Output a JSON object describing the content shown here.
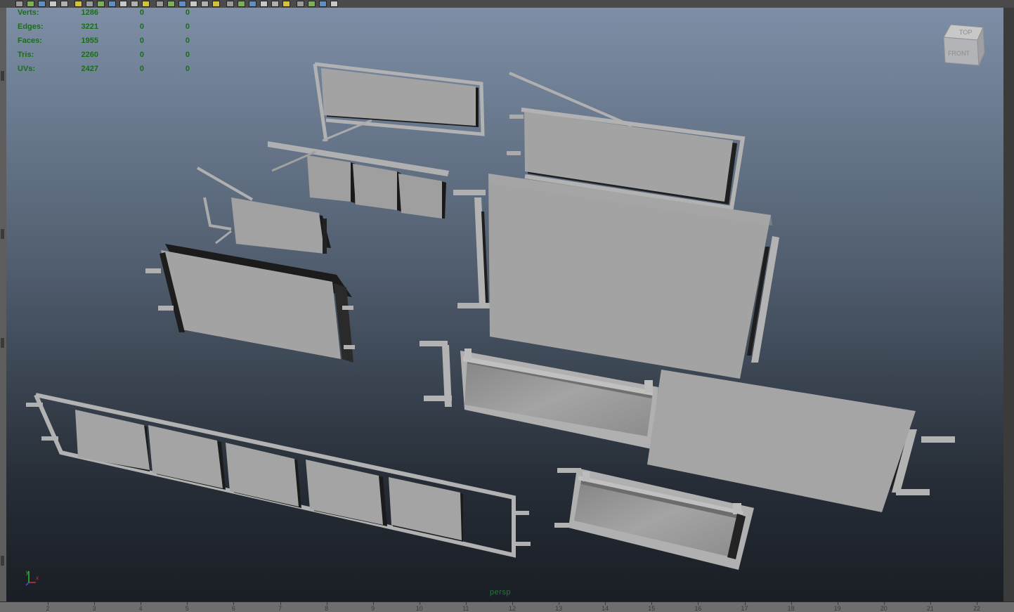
{
  "toolbar": {
    "buttons": [
      "camera-icon",
      "snapshot-icon",
      "render-icon",
      "grid-icon",
      "bookmark-icon",
      "camera-attributes-icon",
      "film-gate-icon",
      "resolution-gate-icon",
      "gate-mask-icon",
      "field-chart-icon",
      "safe-action-icon",
      "safe-title-icon",
      "wireframe-icon",
      "smooth-shade-icon",
      "bounding-box-icon",
      "flat-shade-icon",
      "textured-icon",
      "lights-icon",
      "shadows-icon",
      "ambient-occlusion-icon",
      "motion-blur-icon",
      "anti-alias-icon",
      "depth-of-field-icon",
      "xray-icon",
      "isolate-select-icon",
      "xray-joints-icon",
      "xray-active-icon",
      "backface-icon"
    ]
  },
  "hud": {
    "rows": [
      {
        "label": "Verts:",
        "v1": "1286",
        "v2": "0",
        "v3": "0"
      },
      {
        "label": "Edges:",
        "v1": "3221",
        "v2": "0",
        "v3": "0"
      },
      {
        "label": "Faces:",
        "v1": "1955",
        "v2": "0",
        "v3": "0"
      },
      {
        "label": "Tris:",
        "v1": "2260",
        "v2": "0",
        "v3": "0"
      },
      {
        "label": "UVs:",
        "v1": "2427",
        "v2": "0",
        "v3": "0"
      }
    ]
  },
  "viewcube": {
    "top": "TOP",
    "front": "FRONT"
  },
  "axis": {
    "x": "x",
    "y": "y",
    "z": "z",
    "x_color": "#d03030",
    "y_color": "#30c030",
    "z_color": "#3060e0"
  },
  "camera_label": "persp",
  "timeline": {
    "ticks": [
      "2",
      "3",
      "4",
      "5",
      "6",
      "7",
      "8",
      "9",
      "10",
      "11",
      "12",
      "13",
      "14",
      "15",
      "16",
      "17",
      "18",
      "19",
      "20",
      "21",
      "22"
    ]
  },
  "colors": {
    "panel": "#9d9d9d",
    "frame": "#b4b4b4",
    "shadow": "#1c1c1c",
    "hud_text": "#1a6d1a"
  }
}
